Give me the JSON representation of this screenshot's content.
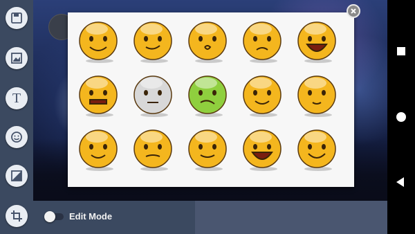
{
  "toolbar": {
    "tools": [
      {
        "name": "save-icon"
      },
      {
        "name": "image-icon"
      },
      {
        "name": "text-icon",
        "glyph": "T"
      },
      {
        "name": "emoji-icon"
      },
      {
        "name": "eraser-icon"
      },
      {
        "name": "crop-icon"
      }
    ]
  },
  "bottom": {
    "edit_mode_label": "Edit Mode",
    "edit_mode_on": false
  },
  "stickers": [
    {
      "name": "sweating-smile-emoji-icon",
      "face": "#f4b61e"
    },
    {
      "name": "winking-emoji-icon",
      "face": "#f4b61e"
    },
    {
      "name": "surprised-emoji-icon",
      "face": "#f4b61e"
    },
    {
      "name": "crying-emoji-icon",
      "face": "#f4b61e"
    },
    {
      "name": "laughing-squint-emoji-icon",
      "face": "#f4b61e"
    },
    {
      "name": "grimacing-emoji-icon",
      "face": "#f4b61e"
    },
    {
      "name": "skull-emoji-icon",
      "face": "#d8d8d8"
    },
    {
      "name": "zombie-emoji-icon",
      "face": "#8fcf3e"
    },
    {
      "name": "drooling-emoji-icon",
      "face": "#f4b61e"
    },
    {
      "name": "dizzy-emoji-icon",
      "face": "#f4b61e"
    },
    {
      "name": "headphones-emoji-icon",
      "face": "#f4b61e"
    },
    {
      "name": "devil-emoji-icon",
      "face": "#f4b61e"
    },
    {
      "name": "trash-can-emoji-icon",
      "face": "#f4b61e"
    },
    {
      "name": "big-grin-emoji-icon",
      "face": "#f4b61e"
    },
    {
      "name": "smile-emoji-icon",
      "face": "#f4b61e"
    }
  ],
  "colors": {
    "toolbar": "#3b4960",
    "panel": "#f7f7f7",
    "face_yellow": "#f4b61e"
  }
}
